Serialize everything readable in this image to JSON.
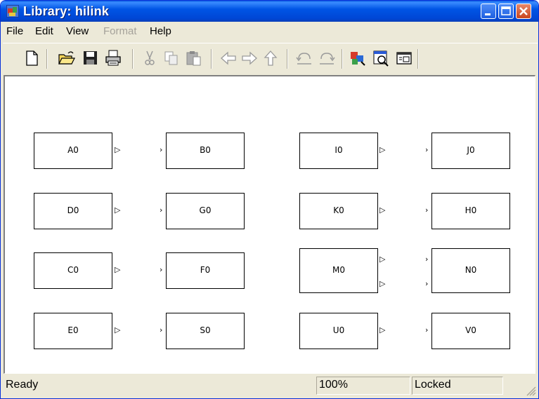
{
  "window": {
    "title": "Library: hilink",
    "title_color": "#0055e5"
  },
  "menu": [
    {
      "label": "File",
      "enabled": true
    },
    {
      "label": "Edit",
      "enabled": true
    },
    {
      "label": "View",
      "enabled": true
    },
    {
      "label": "Format",
      "enabled": false
    },
    {
      "label": "Help",
      "enabled": true
    }
  ],
  "toolbar": {
    "icons": [
      "new-document-icon",
      "open-folder-icon",
      "save-icon",
      "print-icon",
      "cut-icon",
      "copy-icon",
      "paste-icon",
      "back-arrow-icon",
      "forward-arrow-icon",
      "up-arrow-icon",
      "undo-icon",
      "redo-icon",
      "library-browser-icon",
      "model-explorer-icon",
      "debugger-icon"
    ]
  },
  "blocks": [
    {
      "label": "A0"
    },
    {
      "label": "B0"
    },
    {
      "label": "I0"
    },
    {
      "label": "J0"
    },
    {
      "label": "D0"
    },
    {
      "label": "G0"
    },
    {
      "label": "K0"
    },
    {
      "label": "H0"
    },
    {
      "label": "C0"
    },
    {
      "label": "F0"
    },
    {
      "label": "M0"
    },
    {
      "label": "N0"
    },
    {
      "label": "E0"
    },
    {
      "label": "S0"
    },
    {
      "label": "U0"
    },
    {
      "label": "V0"
    }
  ],
  "status": {
    "state": "Ready",
    "zoom": "100%",
    "lock": "Locked"
  }
}
